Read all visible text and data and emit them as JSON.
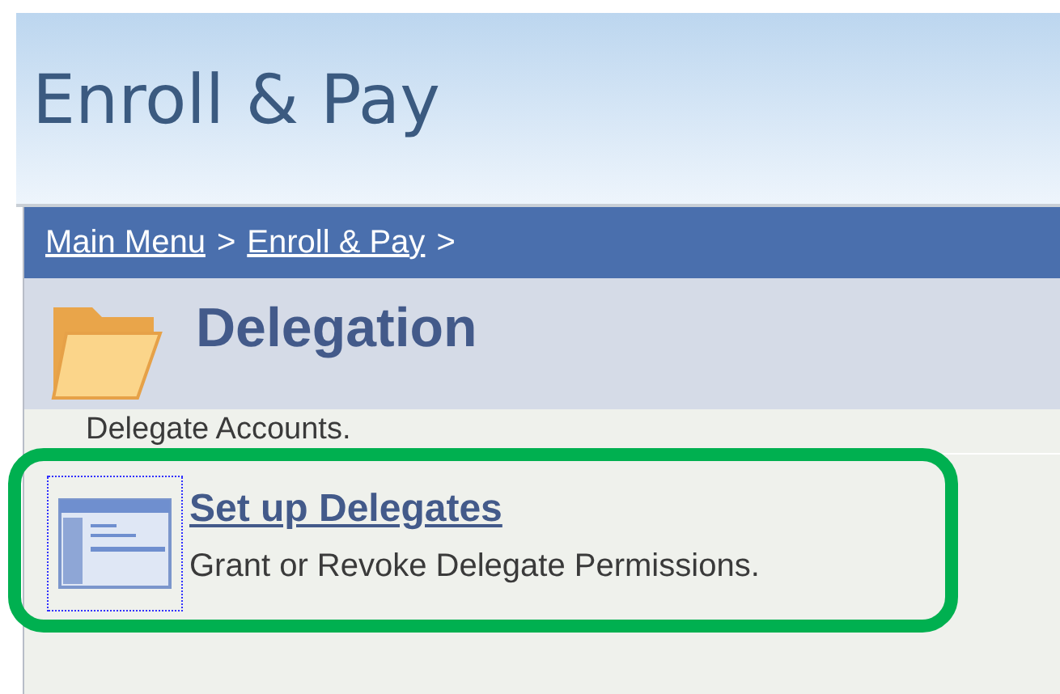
{
  "header": {
    "title": "Enroll & Pay"
  },
  "breadcrumb": [
    {
      "label": "Main Menu",
      "kind": "link"
    },
    {
      "label": ">",
      "kind": "separator"
    },
    {
      "label": "Enroll & Pay",
      "kind": "link"
    },
    {
      "label": ">",
      "kind": "separator"
    }
  ],
  "page_title": "Delegation",
  "description": "Delegate Accounts.",
  "items": [
    {
      "title": "Set up Delegates",
      "subtitle": "Grant or Revoke Delegate Permissions.",
      "highlighted": true
    }
  ]
}
